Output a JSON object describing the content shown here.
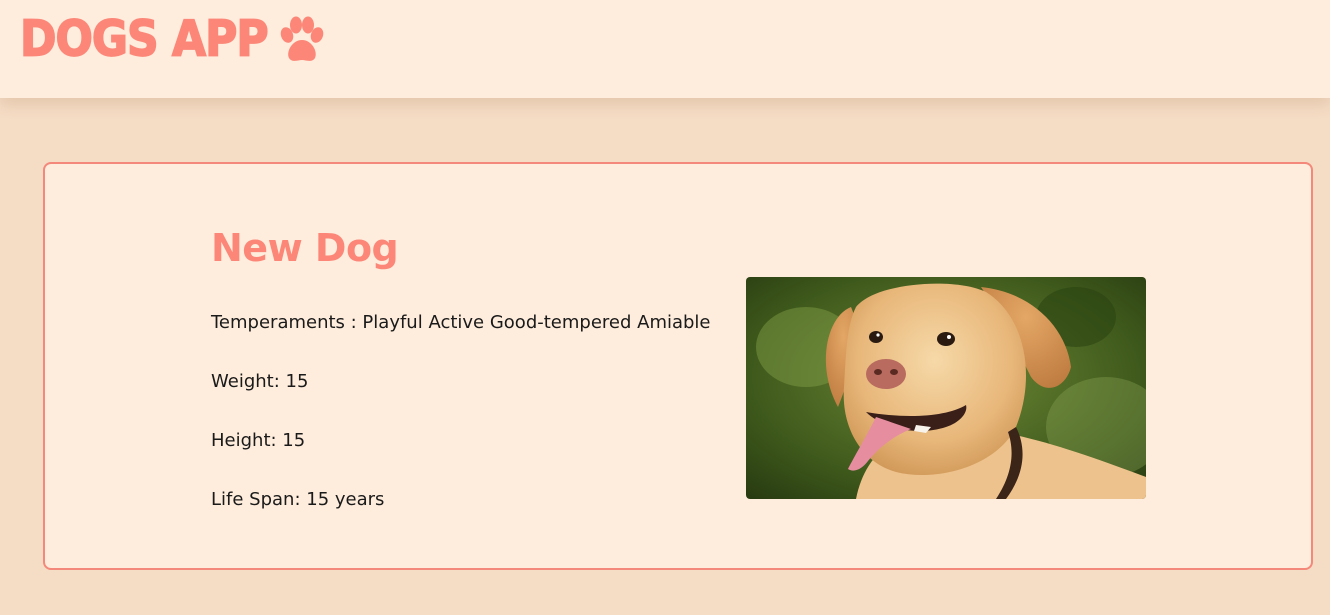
{
  "navbar": {
    "logo_text": "DOGS APP",
    "logo_icon": "paw-icon",
    "accent_color": "#fc8778",
    "background_color": "#feecdc"
  },
  "dog": {
    "name": "New Dog",
    "temperaments": "Temperaments : Playful Active Good-tempered Amiable",
    "weight": "Weight: 15",
    "height": "Height: 15",
    "life_span": "Life Span: 15 years",
    "image_subject": "golden-retriever-photo"
  },
  "colors": {
    "page_background": "#f5dcc4",
    "card_background": "#feecdc",
    "card_border": "#f4887b",
    "text": "#1a1a1a"
  }
}
